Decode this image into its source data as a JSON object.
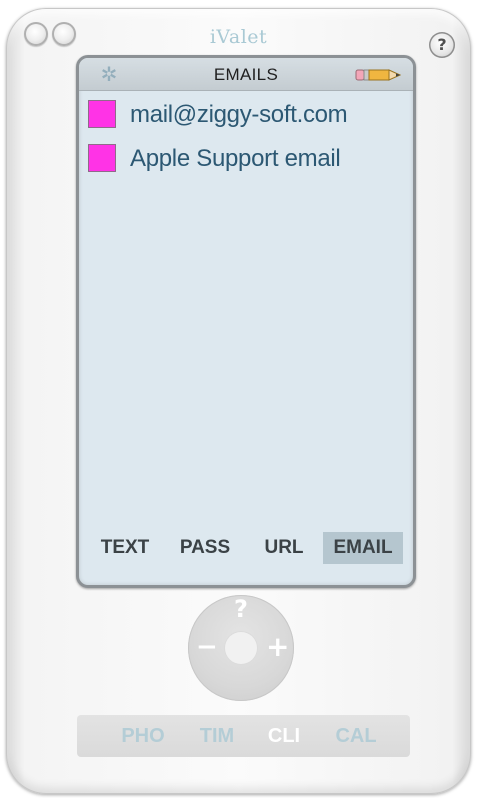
{
  "app": {
    "title": "iValet",
    "help_glyph": "?"
  },
  "screen": {
    "title": "EMAILS",
    "icons": {
      "settings": "gear-icon",
      "edit": "pencil-icon"
    },
    "items": [
      {
        "label": "mail@ziggy-soft.com",
        "color": "#ff33e6"
      },
      {
        "label": "Apple Support email",
        "color": "#ff33e6"
      }
    ],
    "tabs": [
      {
        "label": "TEXT",
        "selected": false
      },
      {
        "label": "PASS",
        "selected": false
      },
      {
        "label": "URL",
        "selected": false
      },
      {
        "label": "EMAIL",
        "selected": true
      }
    ]
  },
  "wheel": {
    "top": "?",
    "left": "−",
    "right": "+"
  },
  "bottom_tabs": [
    {
      "label": "PHO",
      "selected": false
    },
    {
      "label": "TIM",
      "selected": false
    },
    {
      "label": "CLI",
      "selected": true
    },
    {
      "label": "CAL",
      "selected": false
    }
  ],
  "colors": {
    "screen_bg": "#dde8ef",
    "item_text": "#2c5873",
    "selected_tab_bg": "#b5c6cf",
    "bottom_tab_text": "#b4cdd6"
  }
}
